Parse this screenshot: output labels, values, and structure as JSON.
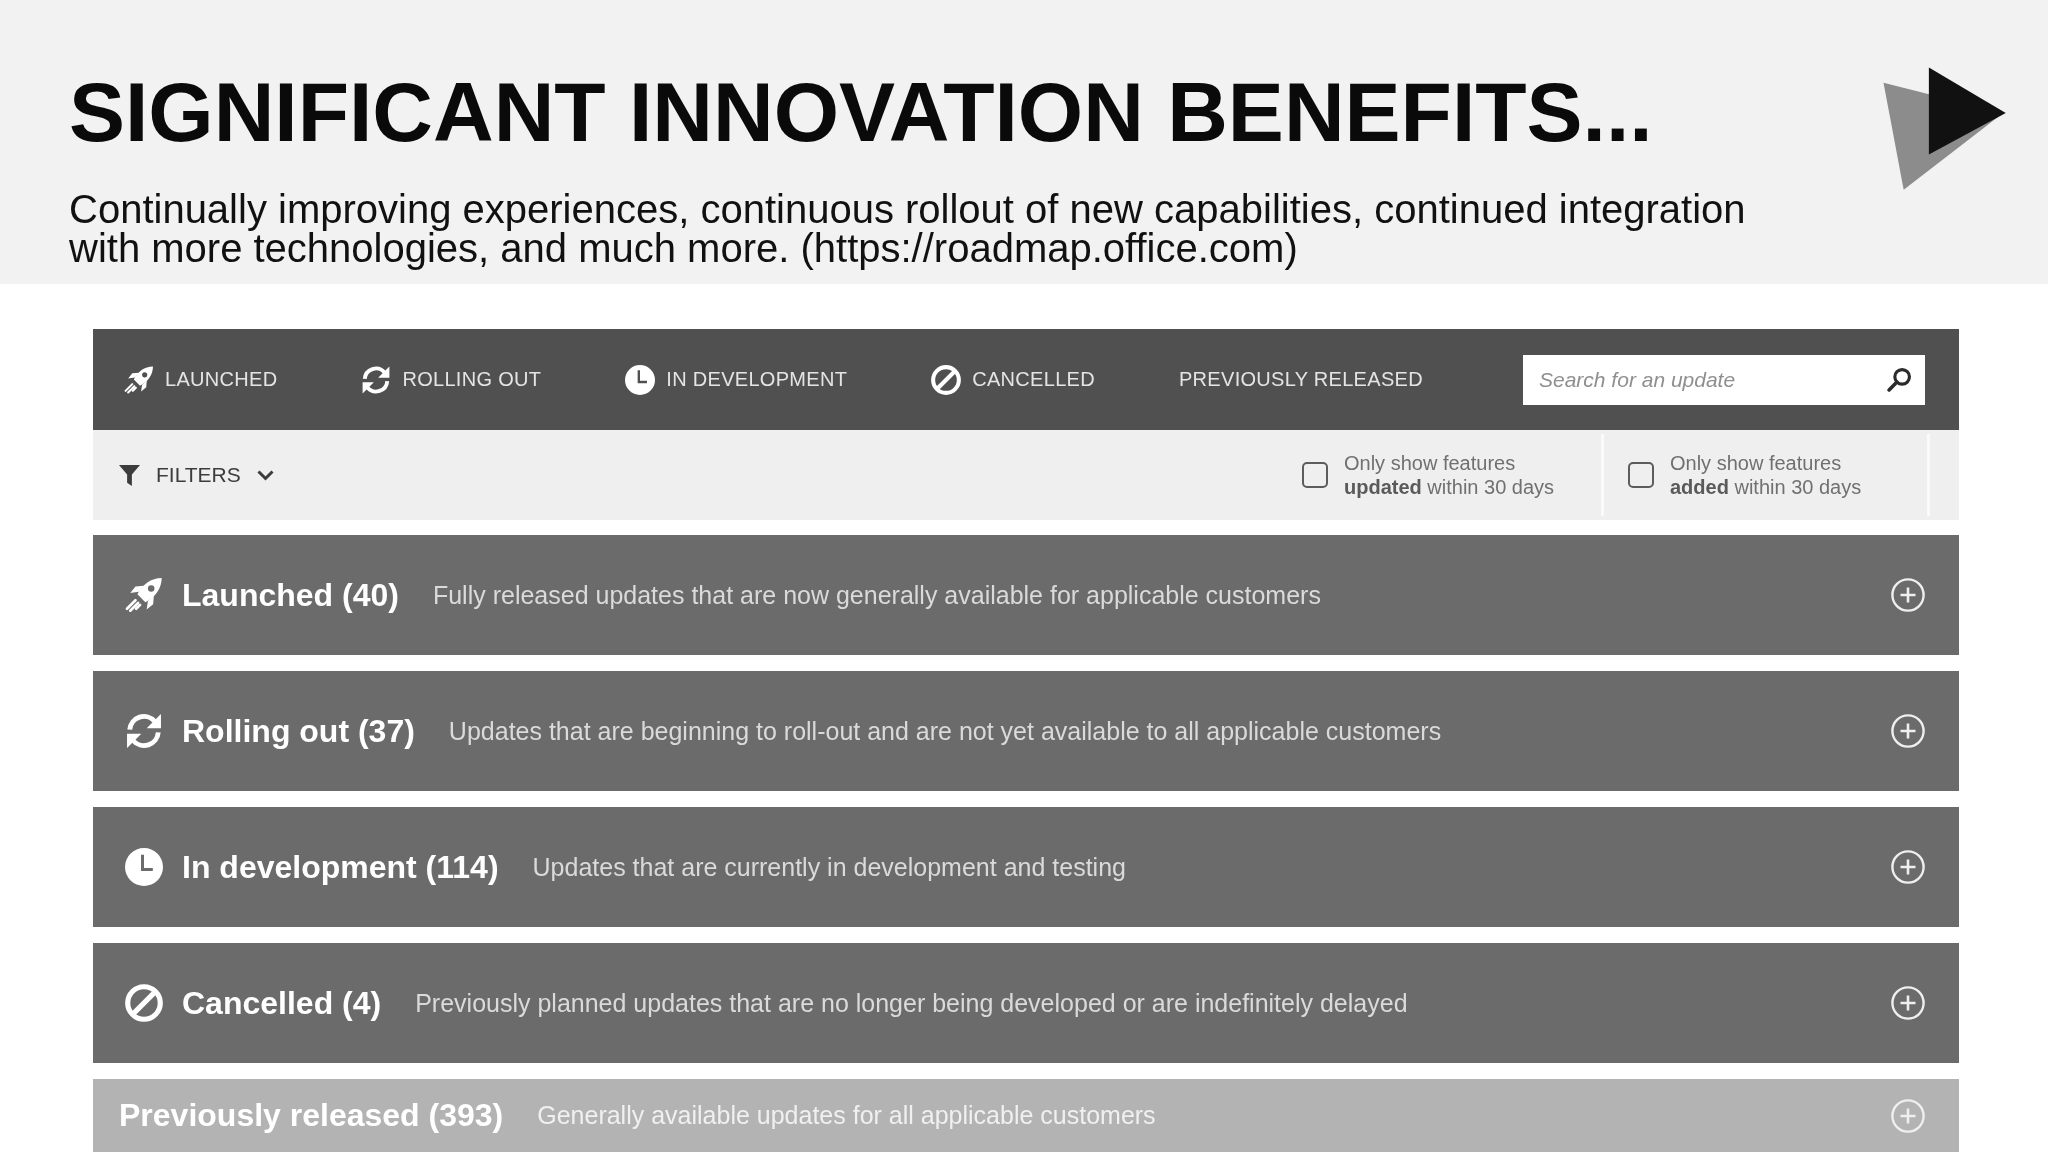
{
  "slide": {
    "title": "SIGNIFICANT INNOVATION BENEFITS...",
    "subtitle": "Continually improving experiences, continuous rollout of new capabilities, continued integration with more technologies, and much more. (https://roadmap.office.com)"
  },
  "nav_tabs": [
    {
      "kind": "launched",
      "label": "LAUNCHED"
    },
    {
      "kind": "rolling",
      "label": "ROLLING OUT"
    },
    {
      "kind": "development",
      "label": "IN DEVELOPMENT"
    },
    {
      "kind": "cancelled",
      "label": "CANCELLED"
    },
    {
      "kind": "released",
      "label": "PREVIOUSLY RELEASED"
    }
  ],
  "search": {
    "placeholder": "Search for an update"
  },
  "filters": {
    "label": "FILTERS",
    "expanded": false
  },
  "checkboxes": [
    {
      "label": "Only show features **updated** within 30 days",
      "checked": false
    },
    {
      "label": "Only show features **added** within 30 days",
      "checked": false
    }
  ],
  "sections": [
    {
      "kind": "launched",
      "title": "Launched (40)",
      "description": "Fully released updates that are now generally available for applicable customers",
      "expanded": false
    },
    {
      "kind": "rolling",
      "title": "Rolling out (37)",
      "description": "Updates that are beginning to roll-out and are not yet available to all applicable customers",
      "expanded": false
    },
    {
      "kind": "development",
      "title": "In development (114)",
      "description": "Updates that are currently in development and testing",
      "expanded": false
    },
    {
      "kind": "cancelled",
      "title": "Cancelled (4)",
      "description": "Previously planned updates that are no longer being developed or are indefinitely delayed",
      "expanded": false
    },
    {
      "kind": "released",
      "title": "Previously released (393)",
      "description": "Generally available updates for all applicable customers",
      "expanded": false
    }
  ]
}
